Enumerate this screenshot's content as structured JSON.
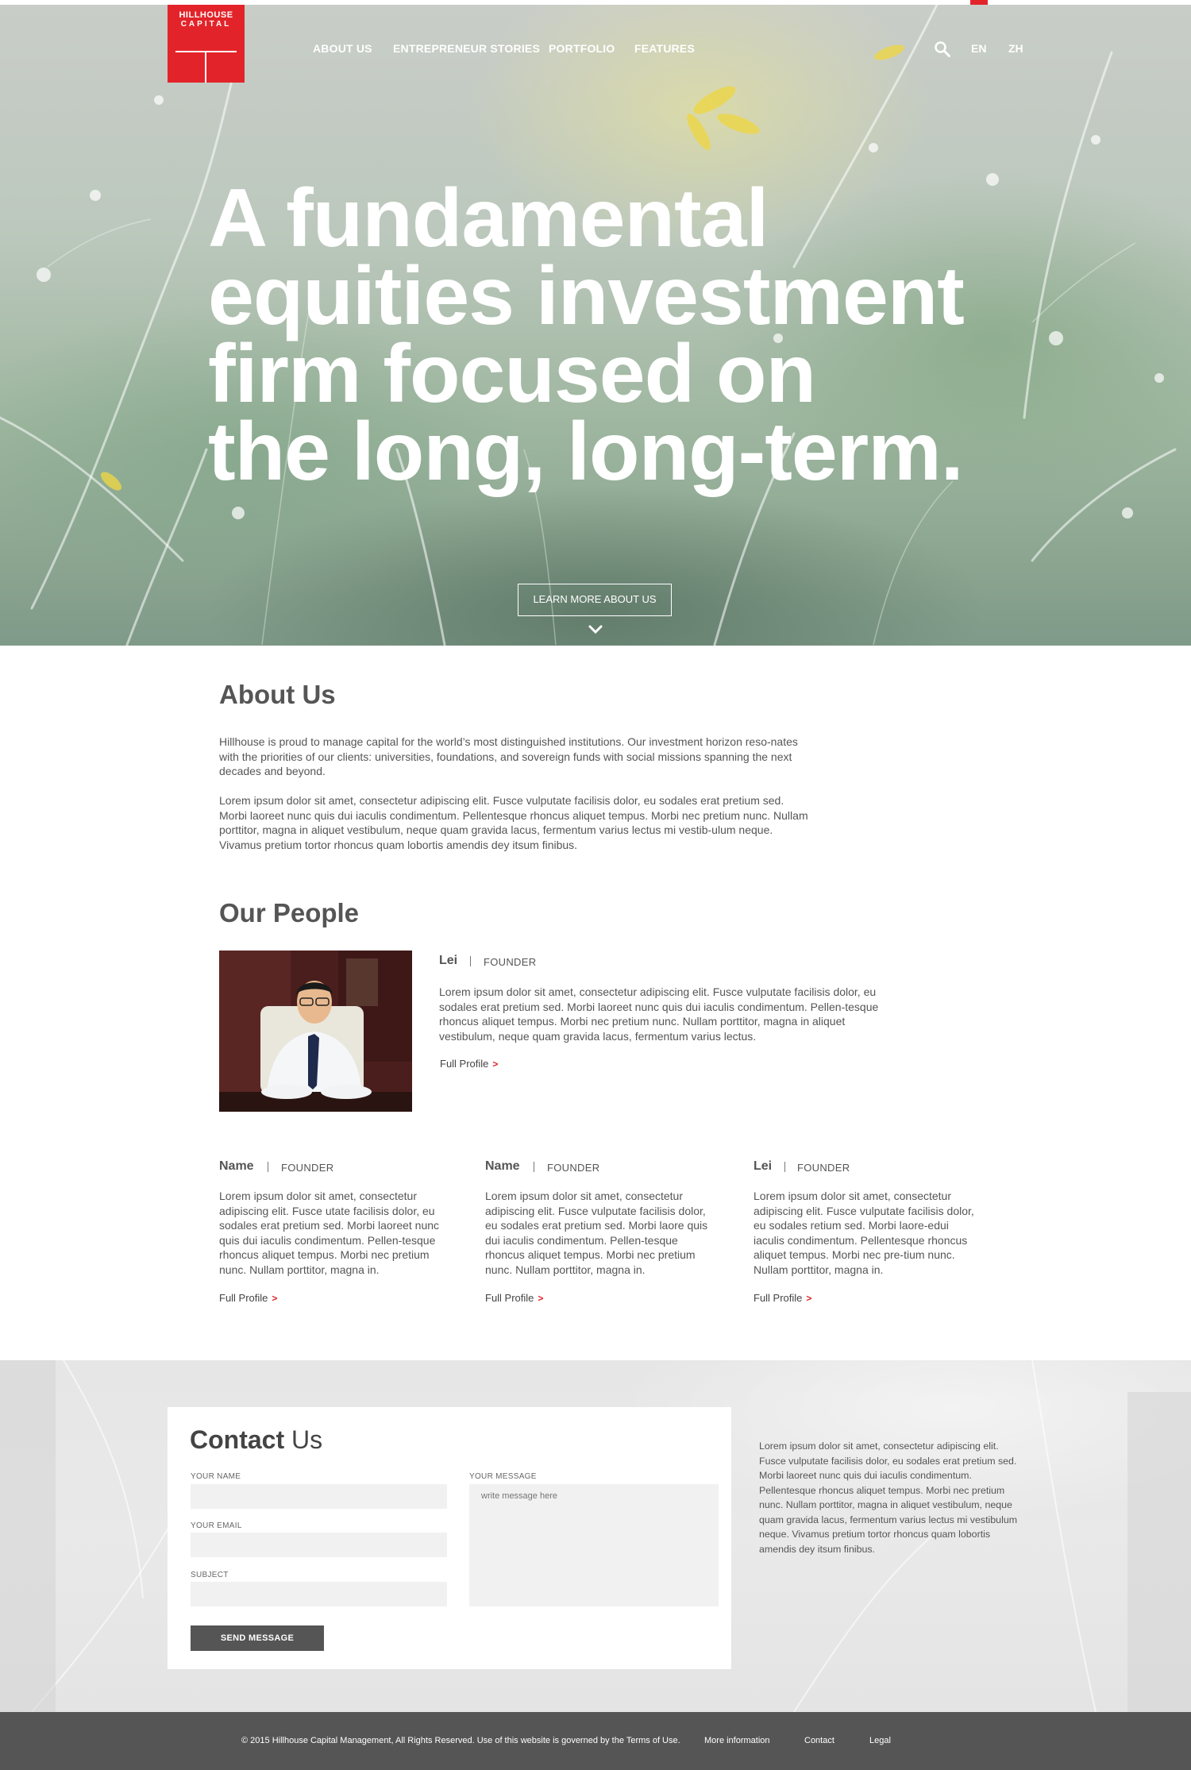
{
  "brand": {
    "logo_line1": "HILLHOUSE",
    "logo_line2": "CAPITAL",
    "accent_color": "#e2242a"
  },
  "nav": {
    "items": [
      "ABOUT US",
      "ENTREPRENEUR STORIES",
      "PORTFOLIO",
      "FEATURES"
    ],
    "search_icon": "search-icon",
    "languages": [
      "EN",
      "ZH"
    ]
  },
  "hero": {
    "headline_lines": [
      "A fundamental",
      "equities investment",
      "firm focused on",
      "the long, long-term."
    ],
    "cta_label": "LEARN MORE ABOUT US",
    "scroll_icon": "chevron-down-icon"
  },
  "about": {
    "title": "About Us",
    "paragraph1": "Hillhouse is proud to manage capital for the world’s most distinguished institutions. Our investment horizon reso-nates with the priorities of our clients: universities, foundations, and sovereign funds with social missions spanning the next decades and beyond.",
    "paragraph2": "Lorem ipsum dolor sit amet, consectetur adipiscing elit. Fusce vulputate facilisis dolor, eu sodales erat pretium sed. Morbi laoreet nunc quis dui iaculis condimentum. Pellentesque rhoncus aliquet tempus. Morbi nec pretium nunc. Nullam porttitor, magna in aliquet vestibulum, neque quam gravida lacus, fermentum varius lectus mi vestib-ulum neque. Vivamus pretium tortor rhoncus quam lobortis amendis dey itsum finibus."
  },
  "people": {
    "title": "Our People",
    "featured": {
      "name": "Lei",
      "role": "FOUNDER",
      "bio": "Lorem ipsum dolor sit amet, consectetur adipiscing elit. Fusce vulputate facilisis dolor, eu sodales erat pretium sed. Morbi laoreet nunc quis dui iaculis condimentum. Pellen-tesque rhoncus aliquet tempus. Morbi nec pretium nunc. Nullam porttitor, magna in aliquet vestibulum, neque quam gravida lacus, fermentum varius lectus.",
      "link": "Full Profile"
    },
    "members": [
      {
        "name": "Name",
        "role": "FOUNDER",
        "bio": "Lorem ipsum dolor sit amet, consectetur adipiscing elit. Fusce utate facilisis dolor, eu sodales erat pretium sed. Morbi laoreet nunc quis dui iaculis condimentum. Pellen-tesque rhoncus aliquet tempus. Morbi nec pretium nunc. Nullam porttitor, magna in.",
        "link": "Full Profile"
      },
      {
        "name": "Name",
        "role": "FOUNDER",
        "bio": "Lorem ipsum dolor sit amet, consectetur adipiscing elit. Fusce vulputate facilisis dolor, eu sodales erat pretium sed. Morbi laore quis dui iaculis condimentum. Pellen-tesque rhoncus aliquet tempus. Morbi nec pretium nunc. Nullam porttitor, magna in.",
        "link": "Full Profile"
      },
      {
        "name": "Lei",
        "role": "FOUNDER",
        "bio": "Lorem ipsum dolor sit amet, consectetur adipiscing elit. Fusce vulputate facilisis dolor, eu sodales retium sed. Morbi laore-edui iaculis condimentum. Pellentesque rhoncus aliquet tempus. Morbi nec pre-tium nunc. Nullam porttitor, magna in.",
        "link": "Full Profile"
      }
    ]
  },
  "contact": {
    "title_bold": "Contact",
    "title_light": "Us",
    "fields": {
      "name_label": "YOUR NAME",
      "email_label": "YOUR EMAIL",
      "subject_label": "SUBJECT",
      "message_label": "YOUR MESSAGE",
      "message_placeholder": "write message here",
      "name_value": "",
      "email_value": "",
      "subject_value": ""
    },
    "send_label": "SEND MESSAGE",
    "side_text": "Lorem ipsum dolor sit amet, consectetur adipiscing elit. Fusce vulputate facilisis dolor, eu sodales erat pretium sed. Morbi laoreet nunc quis dui iaculis condimentum. Pellentesque rhoncus aliquet tempus. Morbi nec pretium nunc. Nullam porttitor, magna in aliquet vestibulum, neque quam gravida lacus, fermentum varius lectus mi vestibulum neque. Vivamus pretium tortor rhoncus quam lobortis amendis dey itsum finibus."
  },
  "footer": {
    "copyright": "© 2015 Hillhouse Capital Management, All Rights Reserved. Use of this website is governed by the Terms of Use.",
    "links": [
      "More information",
      "Contact",
      "Legal"
    ]
  }
}
